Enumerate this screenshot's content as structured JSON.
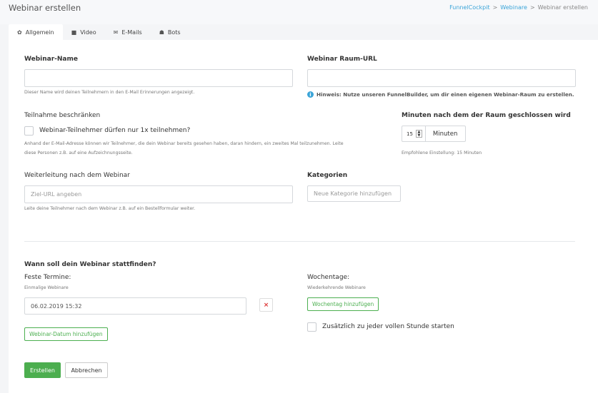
{
  "header": {
    "title": "Webinar erstellen",
    "breadcrumb": [
      "FunnelCockpit",
      "Webinare",
      "Webinar erstellen"
    ],
    "sep": ">"
  },
  "tabs": [
    {
      "icon": "gear-icon",
      "label": "Allgemein",
      "active": true
    },
    {
      "icon": "video-icon",
      "label": "Video"
    },
    {
      "icon": "mail-icon",
      "label": "E-Mails"
    },
    {
      "icon": "bot-icon",
      "label": "Bots"
    }
  ],
  "form": {
    "webinar_name": {
      "label": "Webinar-Name",
      "value": "",
      "help": "Dieser Name wird deinen Teilnehmern in den E-Mail Erinnerungen angezeigt."
    },
    "room_url": {
      "label": "Webinar Raum-URL",
      "value": "",
      "hint": "Hinweis: Nutze unseren FunnelBuilder, um dir einen eigenen Webinar-Raum zu erstellen."
    },
    "restrict": {
      "label": "Teilnahme beschränken",
      "checkbox_label": "Webinar-Teilnehmer dürfen nur 1x teilnehmen?",
      "checked": false,
      "help_line1": "Anhand der E-Mail-Adresse können wir Teilnehmer, die dein Webinar bereits gesehen haben, daran hindern, ein zweites Mal teilzunehmen. Leite",
      "help_line2": "diese Personen z.B. auf eine Aufzeichnungsseite."
    },
    "close_minutes": {
      "label": "Minuten nach dem der Raum geschlossen wird",
      "value": "15",
      "unit": "Minuten",
      "help": "Empfohlene Einstellung: 15 Minuten"
    },
    "redirect": {
      "label": "Weiterleitung nach dem Webinar",
      "placeholder": "Ziel-URL angeben",
      "help": "Leite deine Teilnehmer nach dem Webinar z.B. auf ein Bestellformular weiter."
    },
    "categories": {
      "label": "Kategorien",
      "placeholder": "Neue Kategorie hinzufügen"
    }
  },
  "schedule": {
    "heading": "Wann soll dein Webinar stattfinden?",
    "fixed": {
      "label": "Feste Termine:",
      "sub": "Einmalige Webinare",
      "dates": [
        "06.02.2019 15:32"
      ],
      "add_label": "Webinar-Datum hinzufügen",
      "delete_glyph": "×"
    },
    "weekdays": {
      "label": "Wochentage:",
      "sub": "Wiederkehrende Webinare",
      "add_label": "Wochentag hinzufügen"
    },
    "hourly": {
      "label": "Zusätzlich zu jeder vollen Stunde starten",
      "checked": false
    }
  },
  "actions": {
    "create": "Erstellen",
    "cancel": "Abbrechen"
  }
}
